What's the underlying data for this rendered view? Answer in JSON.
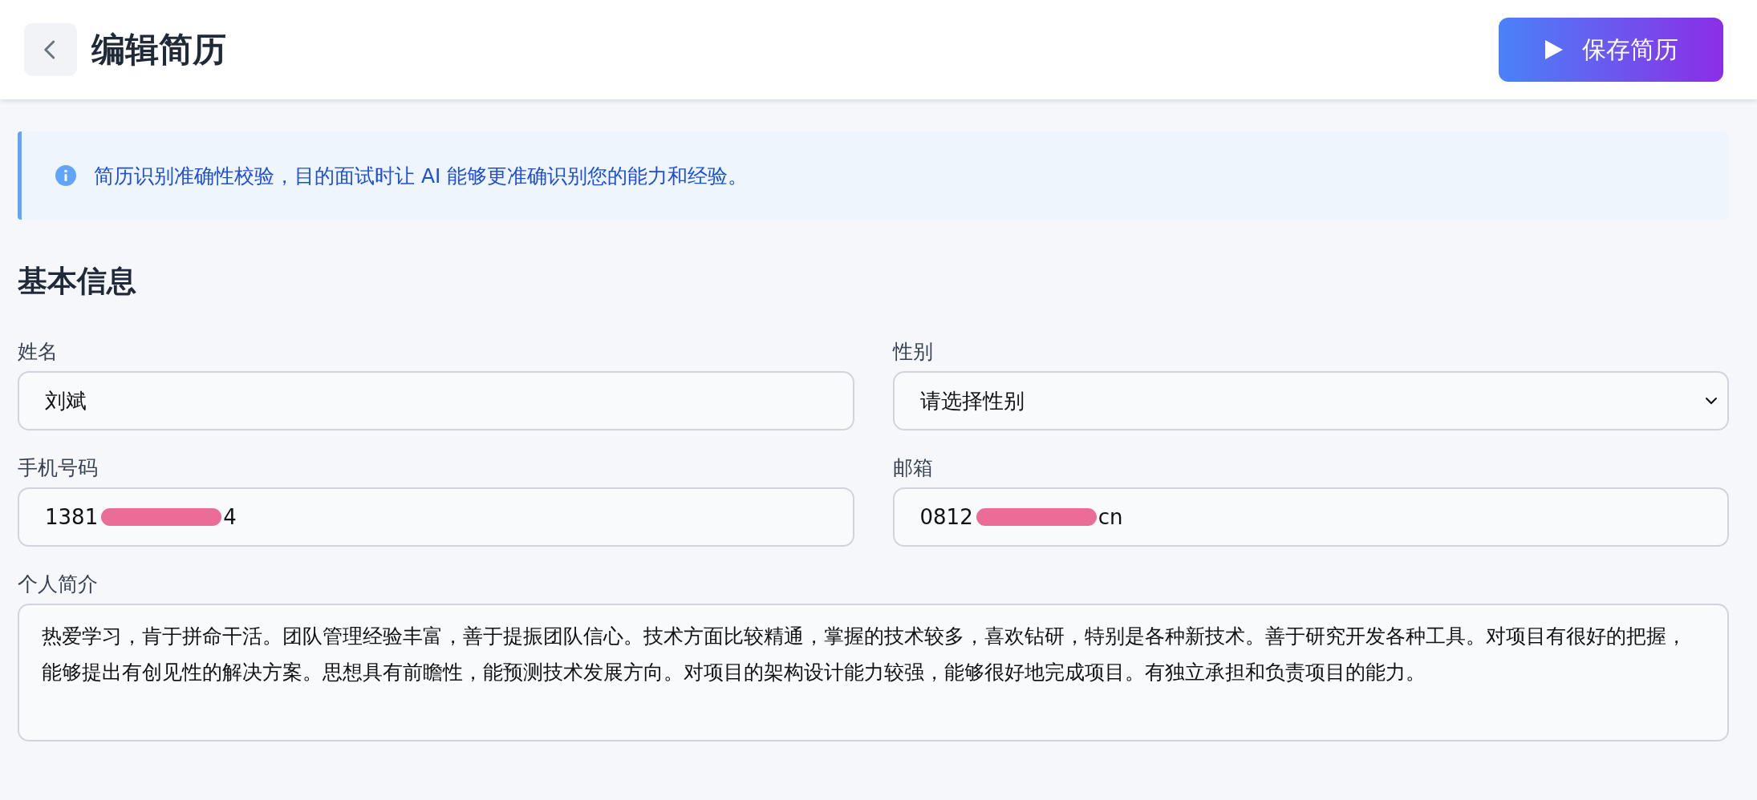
{
  "header": {
    "title": "编辑简历",
    "save_button": "保存简历"
  },
  "notice": {
    "text": "简历识别准确性校验，目的面试时让 AI 能够更准确识别您的能力和经验。"
  },
  "section": {
    "title": "基本信息"
  },
  "fields": [
    {
      "kind": "input",
      "label": "姓名",
      "value": "刘斌"
    },
    {
      "kind": "select",
      "label": "性别",
      "placeholder": "请选择性别"
    },
    {
      "kind": "redacted",
      "label": "手机号码",
      "prefix": "1381",
      "suffix": "4"
    },
    {
      "kind": "redacted",
      "label": "邮箱",
      "prefix": "0812",
      "suffix": "cn"
    },
    {
      "kind": "textarea",
      "label": "个人简介",
      "value": "热爱学习，肯于拼命干活。团队管理经验丰富，善于提振团队信心。技术方面比较精通，掌握的技术较多，喜欢钻研，特别是各种新技术。善于研究开发各种工具。对项目有很好的把握，能够提出有创见性的解决方案。思想具有前瞻性，能预测技术发展方向。对项目的架构设计能力较强，能够很好地完成项目。有独立承担和负责项目的能力。"
    }
  ]
}
